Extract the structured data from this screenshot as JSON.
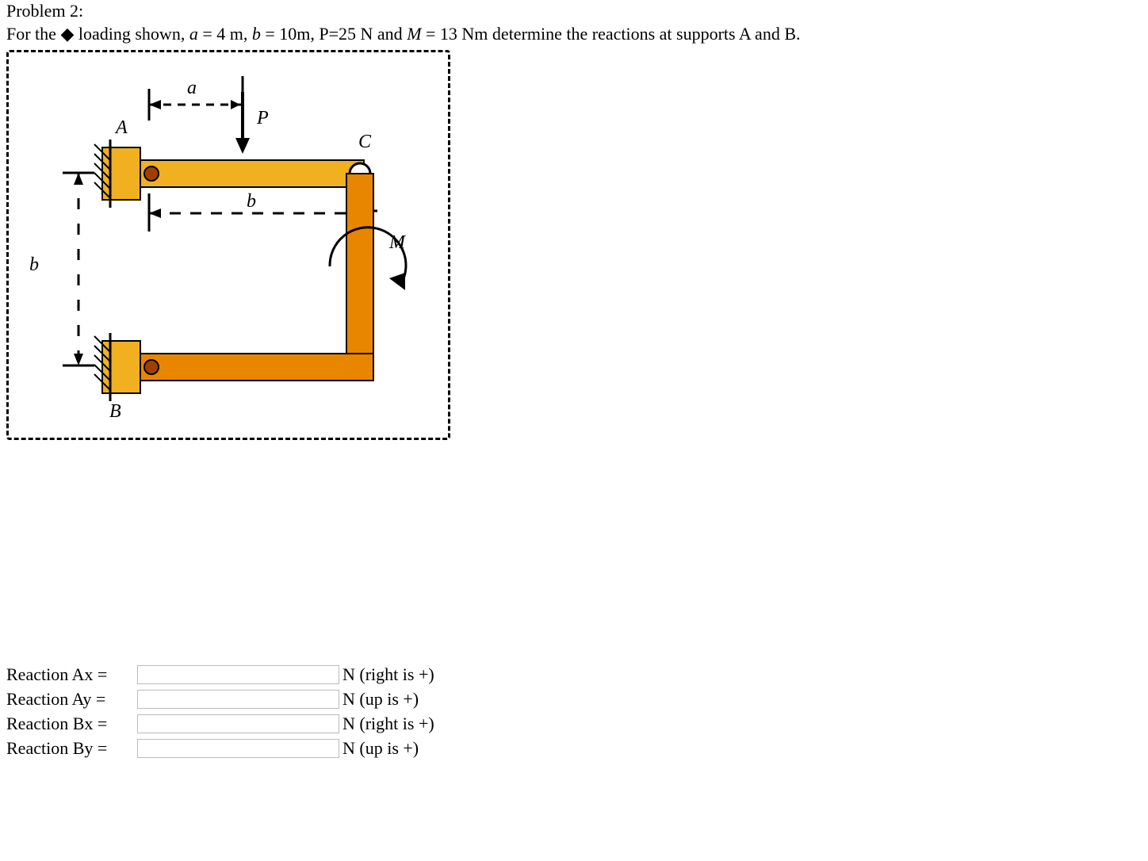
{
  "problem": {
    "title": "Problem 2:",
    "statement_prefix": "For the ",
    "statement_mid": "loading shown, ",
    "a_var": "a",
    "eq1": " = 4 m, ",
    "b_var": "b",
    "eq2": " = 10m, P=25 N and ",
    "m_var": "M",
    "eq3": "= 13 Nm determine the reactions at supports A and B."
  },
  "figure": {
    "labels": {
      "a": "a",
      "A": "A",
      "P": "P",
      "C": "C",
      "b_top": "b",
      "M": "M",
      "b_left": "b",
      "B": "B"
    }
  },
  "answers": {
    "rows": [
      {
        "label": "Reaction Ax =",
        "value": "",
        "unit": "N (right is +)"
      },
      {
        "label": "Reaction Ay =",
        "value": "",
        "unit": "N (up is +)"
      },
      {
        "label": "Reaction Bx =",
        "value": "",
        "unit": "N (right is +)"
      },
      {
        "label": "Reaction By =",
        "value": "",
        "unit": "N (up is +)"
      }
    ]
  }
}
